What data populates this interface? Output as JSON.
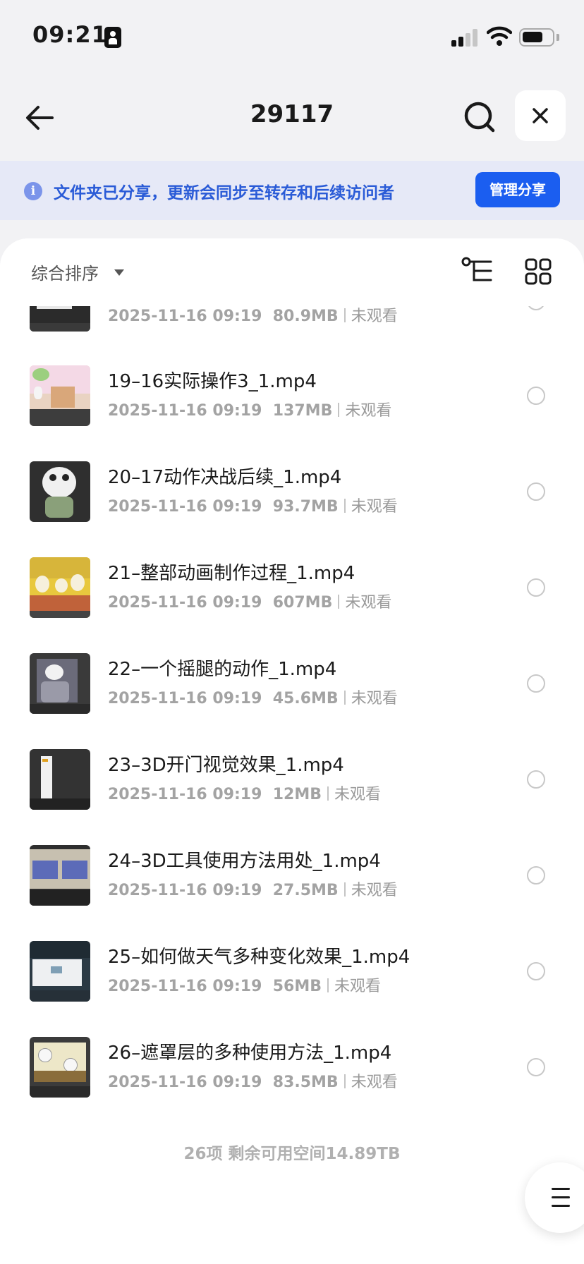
{
  "status_bar": {
    "time": "09:21"
  },
  "header": {
    "title": "29117"
  },
  "share_banner": {
    "text": "文件夹已分享，更新会同步至转存和后续访问者",
    "button": "管理分享"
  },
  "toolbar": {
    "sort_label": "综合排序"
  },
  "files": [
    {
      "name": "",
      "date": "2025-11-16 09:19",
      "size": "80.9MB",
      "status": "未观看"
    },
    {
      "name": "19–16实际操作3_1.mp4",
      "date": "2025-11-16 09:19",
      "size": "137MB",
      "status": "未观看"
    },
    {
      "name": "20–17动作决战后续_1.mp4",
      "date": "2025-11-16 09:19",
      "size": "93.7MB",
      "status": "未观看"
    },
    {
      "name": "21–整部动画制作过程_1.mp4",
      "date": "2025-11-16 09:19",
      "size": "607MB",
      "status": "未观看"
    },
    {
      "name": "22–一个摇腿的动作_1.mp4",
      "date": "2025-11-16 09:19",
      "size": "45.6MB",
      "status": "未观看"
    },
    {
      "name": "23–3D开门视觉效果_1.mp4",
      "date": "2025-11-16 09:19",
      "size": "12MB",
      "status": "未观看"
    },
    {
      "name": "24–3D工具使用方法用处_1.mp4",
      "date": "2025-11-16 09:19",
      "size": "27.5MB",
      "status": "未观看"
    },
    {
      "name": "25–如何做天气多种变化效果_1.mp4",
      "date": "2025-11-16 09:19",
      "size": "56MB",
      "status": "未观看"
    },
    {
      "name": "26–遮罩层的多种使用方法_1.mp4",
      "date": "2025-11-16 09:19",
      "size": "83.5MB",
      "status": "未观看"
    }
  ],
  "footer": {
    "summary": "26项 剩余可用空间14.89TB"
  },
  "colors": {
    "accent": "#1b5ef0",
    "banner_bg": "#e6e9f7",
    "banner_text": "#2a5bd7"
  },
  "icons": [
    "back-arrow-icon",
    "search-icon",
    "close-icon",
    "info-icon",
    "caret-down-icon",
    "tree-view-icon",
    "grid-view-icon",
    "menu-icon"
  ]
}
